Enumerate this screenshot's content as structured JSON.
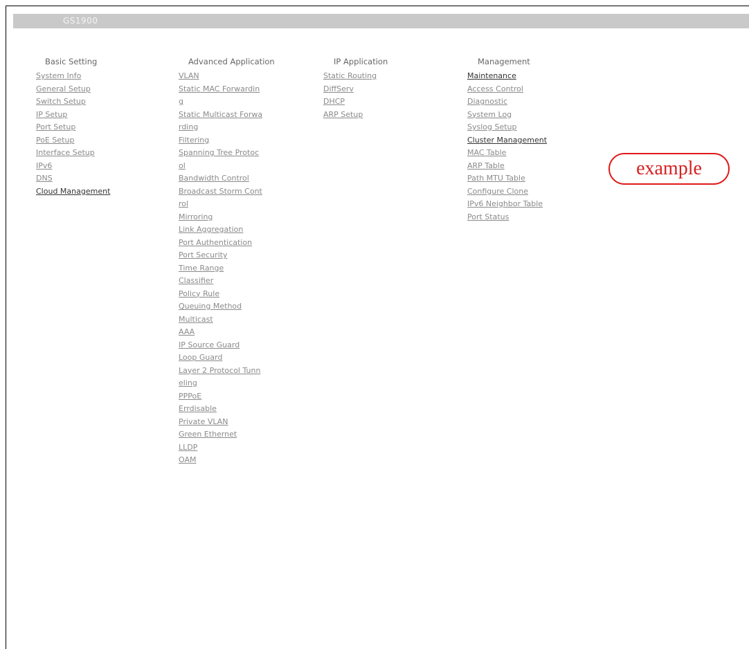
{
  "header": {
    "title": "GS1900"
  },
  "columns": {
    "basic": {
      "heading": "Basic Setting",
      "items": [
        "System Info",
        "General Setup",
        "Switch Setup",
        "IP Setup",
        "Port Setup",
        "PoE Setup",
        "Interface Setup",
        "IPv6",
        "DNS",
        "Cloud Management"
      ]
    },
    "advanced": {
      "heading": "Advanced Application",
      "items": [
        "VLAN",
        "Static MAC Forwardin",
        "g",
        "Static Multicast Forwa",
        "rding",
        "Filtering",
        "Spanning Tree Protoc",
        "ol",
        "Bandwidth Control",
        "Broadcast Storm Cont",
        "rol",
        "Mirroring",
        "Link Aggregation",
        "Port Authentication",
        "Port Security",
        "Time Range",
        "Classifier",
        "Policy Rule",
        "Queuing Method",
        "Multicast",
        "AAA",
        "IP Source Guard",
        "Loop Guard",
        "Layer 2 Protocol Tunn",
        "eling",
        "PPPoE",
        "Errdisable",
        "Private VLAN",
        "Green Ethernet",
        "LLDP",
        "OAM"
      ]
    },
    "ip": {
      "heading": "IP Application",
      "items": [
        "Static Routing",
        "DiffServ",
        "DHCP",
        "ARP Setup"
      ]
    },
    "management": {
      "heading": "Management",
      "items": [
        "Maintenance",
        "Access Control",
        "Diagnostic",
        "System Log",
        "Syslog Setup",
        "Cluster Management",
        "MAC Table",
        "ARP Table",
        "Path MTU Table",
        "Configure Clone",
        "IPv6 Neighbor Table",
        "Port Status"
      ]
    }
  },
  "annotation": {
    "label": "example"
  },
  "colors": {
    "titlebar": "#c9c9c9",
    "link": "#8a8a8a",
    "annotation": "#e01818"
  }
}
